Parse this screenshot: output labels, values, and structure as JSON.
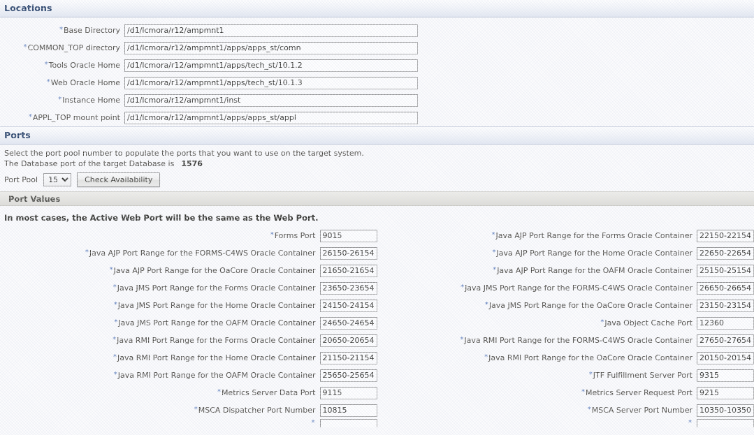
{
  "locations": {
    "section_title": "Locations",
    "fields": [
      {
        "label": "Base Directory",
        "required": true,
        "value": "/d1/lcmora/r12/ampmnt1"
      },
      {
        "label": "COMMON_TOP directory",
        "required": true,
        "value": "/d1/lcmora/r12/ampmnt1/apps/apps_st/comn"
      },
      {
        "label": "Tools Oracle Home",
        "required": true,
        "value": "/d1/lcmora/r12/ampmnt1/apps/tech_st/10.1.2"
      },
      {
        "label": "Web Oracle Home",
        "required": true,
        "value": "/d1/lcmora/r12/ampmnt1/apps/tech_st/10.1.3"
      },
      {
        "label": "Instance Home",
        "required": true,
        "value": "/d1/lcmora/r12/ampmnt1/inst"
      },
      {
        "label": "APPL_TOP mount point",
        "required": true,
        "value": "/d1/lcmora/r12/ampmnt1/apps/apps_st/appl"
      }
    ]
  },
  "ports": {
    "section_title": "Ports",
    "instruction": "Select the port pool number to populate the ports that you want to use on the target system.",
    "db_port_label": "The Database port of the target Database is",
    "db_port_value": "1576",
    "pool_label": "Port Pool",
    "pool_value": "15",
    "pool_options": [
      "15"
    ],
    "check_availability_label": "Check Availability"
  },
  "port_values": {
    "section_title": "Port Values",
    "note": "In most cases, the Active Web Port will be the same as the Web Port.",
    "left_column": [
      {
        "label": "Forms Port",
        "required": true,
        "value": "9015"
      },
      {
        "label": "Java AJP Port Range for the FORMS-C4WS Oracle Container",
        "required": true,
        "value": "26150-26154"
      },
      {
        "label": "Java AJP Port Range for the OaCore Oracle Container",
        "required": true,
        "value": "21650-21654"
      },
      {
        "label": "Java JMS Port Range for the Forms Oracle Container",
        "required": true,
        "value": "23650-23654"
      },
      {
        "label": "Java JMS Port Range for the Home Oracle Container",
        "required": true,
        "value": "24150-24154"
      },
      {
        "label": "Java JMS Port Range for the OAFM Oracle Container",
        "required": true,
        "value": "24650-24654"
      },
      {
        "label": "Java RMI Port Range for the Forms Oracle Container",
        "required": true,
        "value": "20650-20654"
      },
      {
        "label": "Java RMI Port Range for the Home Oracle Container",
        "required": true,
        "value": "21150-21154"
      },
      {
        "label": "Java RMI Port Range for the OAFM Oracle Container",
        "required": true,
        "value": "25650-25654"
      },
      {
        "label": "Metrics Server Data Port",
        "required": true,
        "value": "9115"
      },
      {
        "label": "MSCA Dispatcher Port Number",
        "required": true,
        "value": "10815"
      },
      {
        "label": "",
        "required": true,
        "value": ""
      }
    ],
    "right_column": [
      {
        "label": "Java AJP Port Range for the Forms Oracle Container",
        "required": true,
        "value": "22150-22154"
      },
      {
        "label": "Java AJP Port Range for the Home Oracle Container",
        "required": true,
        "value": "22650-22654"
      },
      {
        "label": "Java AJP Port Range for the OAFM Oracle Container",
        "required": true,
        "value": "25150-25154"
      },
      {
        "label": "Java JMS Port Range for the FORMS-C4WS Oracle Container",
        "required": true,
        "value": "26650-26654"
      },
      {
        "label": "Java JMS Port Range for the OaCore Oracle Container",
        "required": true,
        "value": "23150-23154"
      },
      {
        "label": "Java Object Cache Port",
        "required": true,
        "value": "12360"
      },
      {
        "label": "Java RMI Port Range for the FORMS-C4WS Oracle Container",
        "required": true,
        "value": "27650-27654"
      },
      {
        "label": "Java RMI Port Range for the OaCore Oracle Container",
        "required": true,
        "value": "20150-20154"
      },
      {
        "label": "JTF Fulfillment Server Port",
        "required": true,
        "value": "9315"
      },
      {
        "label": "Metrics Server Request Port",
        "required": true,
        "value": "9215"
      },
      {
        "label": "MSCA Server Port Number",
        "required": true,
        "value": "10350-10350"
      },
      {
        "label": "",
        "required": true,
        "value": ""
      }
    ]
  },
  "colors": {
    "section_header_text": "#1f3a63",
    "required_marker": "#4a6fb5",
    "label_text": "#44423c",
    "page_background": "#fcfcfd"
  }
}
